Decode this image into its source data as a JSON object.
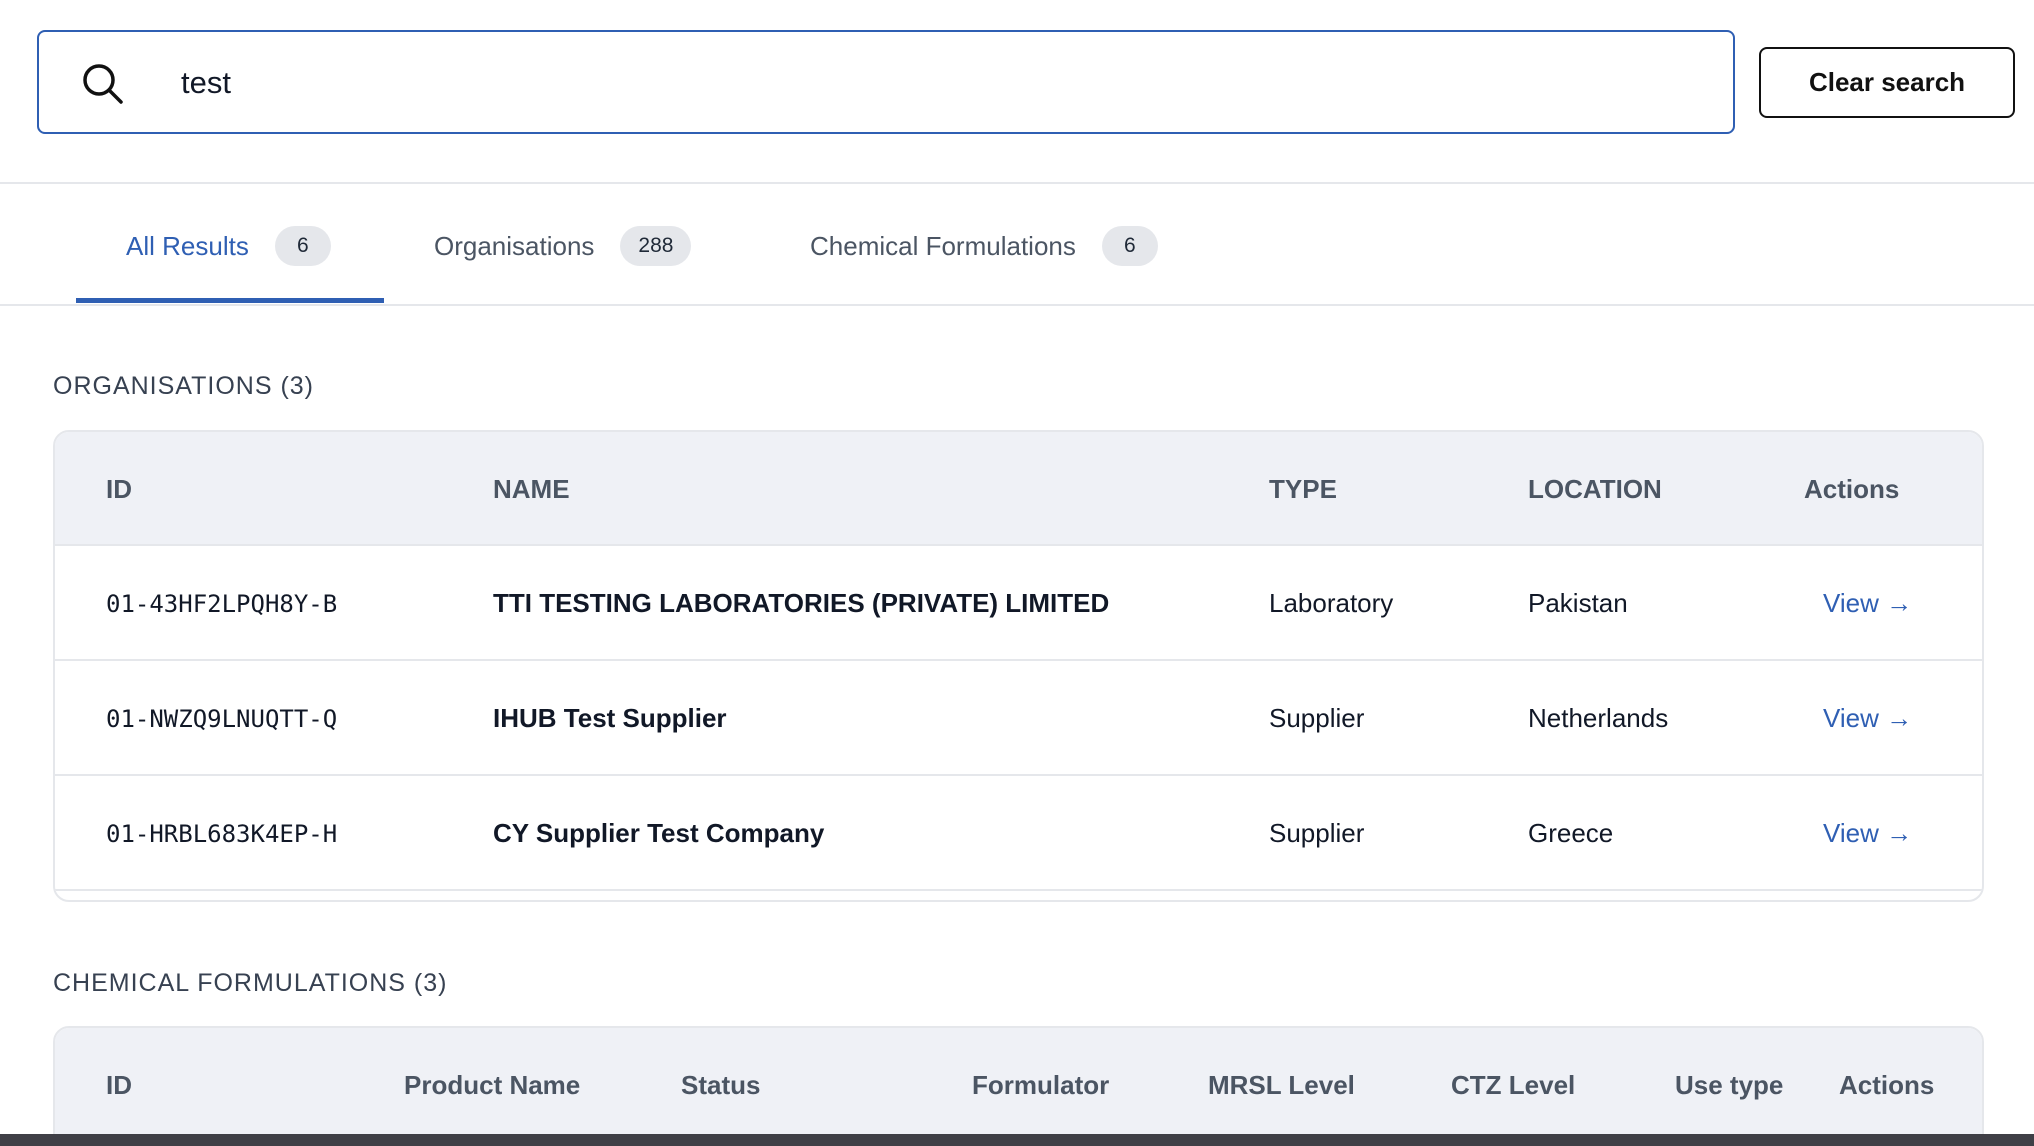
{
  "search": {
    "value": "test",
    "clear_label": "Clear search"
  },
  "tabs": [
    {
      "label": "All Results",
      "count": "6",
      "active": true
    },
    {
      "label": "Organisations",
      "count": "288",
      "active": false
    },
    {
      "label": "Chemical Formulations",
      "count": "6",
      "active": false
    }
  ],
  "organisations": {
    "title": "ORGANISATIONS (3)",
    "columns": [
      "ID",
      "NAME",
      "TYPE",
      "LOCATION",
      "Actions"
    ],
    "rows": [
      {
        "id": "01-43HF2LPQH8Y-B",
        "name": "TTI TESTING LABORATORIES (PRIVATE) LIMITED",
        "type": "Laboratory",
        "location": "Pakistan",
        "action": "View →"
      },
      {
        "id": "01-NWZQ9LNUQTT-Q",
        "name": "IHUB Test Supplier",
        "type": "Supplier",
        "location": "Netherlands",
        "action": "View →"
      },
      {
        "id": "01-HRBL683K4EP-H",
        "name": "CY Supplier Test Company",
        "type": "Supplier",
        "location": "Greece",
        "action": "View →"
      }
    ]
  },
  "chemical_formulations": {
    "title": "CHEMICAL FORMULATIONS (3)",
    "columns": [
      "ID",
      "Product Name",
      "Status",
      "Formulator",
      "MRSL Level",
      "CTZ Level",
      "Use type",
      "Actions"
    ]
  },
  "colors": {
    "accent": "#2f5fb3",
    "header_bg": "#eff1f6",
    "border": "#e5e7eb"
  }
}
